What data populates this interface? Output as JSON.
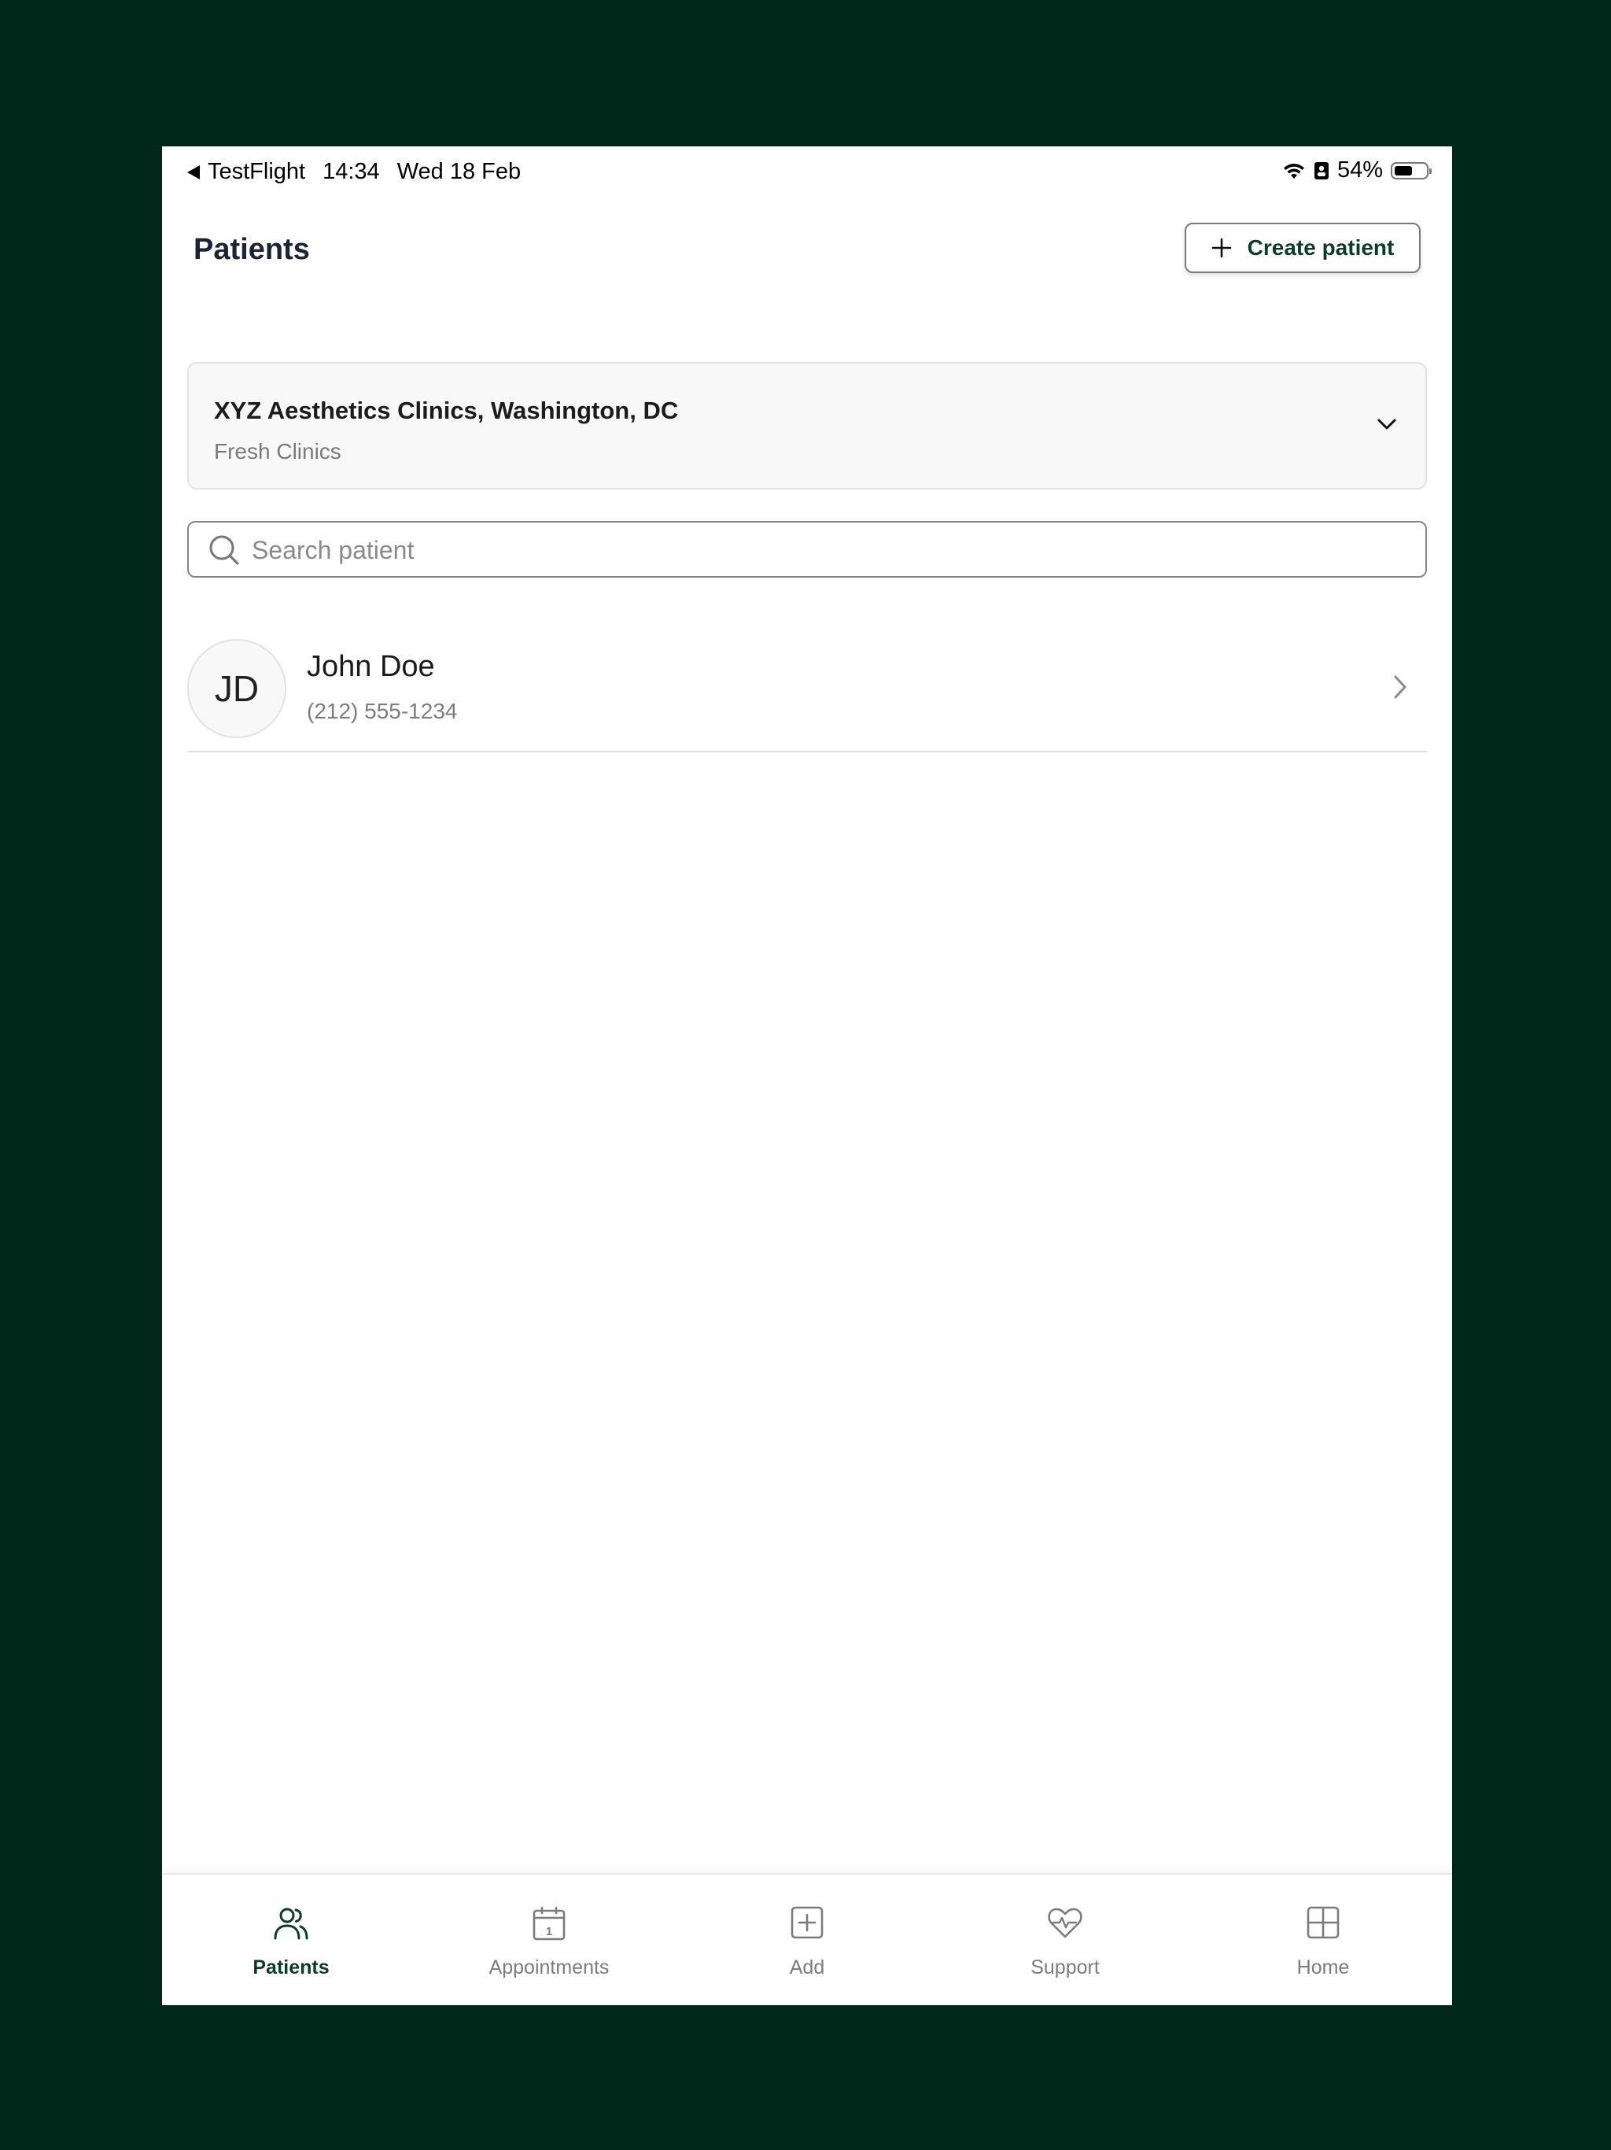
{
  "status_bar": {
    "back_app": "TestFlight",
    "time": "14:34",
    "date": "Wed 18 Feb",
    "battery": "54%",
    "battery_level": 0.54
  },
  "header": {
    "title": "Patients",
    "create_label": "Create patient"
  },
  "clinic": {
    "name": "XYZ Aesthetics Clinics, Washington, DC",
    "subtitle": "Fresh Clinics"
  },
  "search": {
    "placeholder": "Search patient"
  },
  "patients": [
    {
      "initials": "JD",
      "name": "John Doe",
      "phone": "(212) 555-1234"
    }
  ],
  "tabs": [
    {
      "label": "Patients",
      "icon": "users-icon",
      "active": true
    },
    {
      "label": "Appointments",
      "icon": "calendar-icon",
      "calendar_day": "1",
      "active": false
    },
    {
      "label": "Add",
      "icon": "plus-square-icon",
      "active": false
    },
    {
      "label": "Support",
      "icon": "heart-pulse-icon",
      "active": false
    },
    {
      "label": "Home",
      "icon": "grid-icon",
      "active": false
    }
  ],
  "colors": {
    "brand_dark": "#0d3b2a",
    "background_frame": "#00281a",
    "muted_text": "#7c7c7c"
  }
}
